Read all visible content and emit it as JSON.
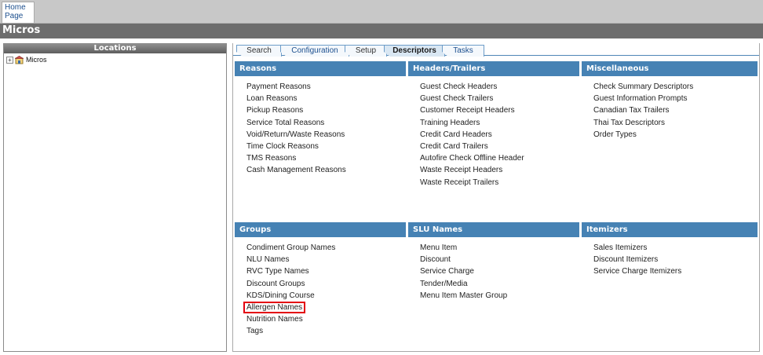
{
  "top_bar": {
    "home_tab": "Home\nPage"
  },
  "title_bar": {
    "title": "Micros"
  },
  "locations": {
    "header": "Locations",
    "tree": [
      {
        "expander": "+",
        "label": "Micros"
      }
    ]
  },
  "tabs": [
    {
      "label": "Search"
    },
    {
      "label": "Configuration"
    },
    {
      "label": "Setup"
    },
    {
      "label": "Descriptors",
      "active": true
    },
    {
      "label": "Tasks"
    }
  ],
  "sections": {
    "reasons": {
      "title": "Reasons",
      "items": [
        "Payment Reasons",
        "Loan Reasons",
        "Pickup Reasons",
        "Service Total Reasons",
        "Void/Return/Waste Reasons",
        "Time Clock Reasons",
        "TMS Reasons",
        "Cash Management Reasons"
      ]
    },
    "headers_trailers": {
      "title": "Headers/Trailers",
      "items": [
        "Guest Check Headers",
        "Guest Check Trailers",
        "Customer Receipt Headers",
        "Training Headers",
        "Credit Card Headers",
        "Credit Card Trailers",
        "Autofire Check Offline Header",
        "Waste Receipt Headers",
        "Waste Receipt Trailers"
      ]
    },
    "miscellaneous": {
      "title": "Miscellaneous",
      "items": [
        "Check Summary Descriptors",
        "Guest Information Prompts",
        "Canadian Tax Trailers",
        "Thai Tax Descriptors",
        "Order Types"
      ]
    },
    "groups": {
      "title": "Groups",
      "items": [
        "Condiment Group Names",
        "NLU Names",
        "RVC Type Names",
        "Discount Groups",
        "KDS/Dining Course",
        "Allergen Names",
        "Nutrition Names",
        "Tags"
      ],
      "highlighted": "Allergen Names"
    },
    "slu_names": {
      "title": "SLU Names",
      "items": [
        "Menu Item",
        "Discount",
        "Service Charge",
        "Tender/Media",
        "Menu Item Master Group"
      ]
    },
    "itemizers": {
      "title": "Itemizers",
      "items": [
        "Sales Itemizers",
        "Discount Itemizers",
        "Service Charge Itemizers"
      ]
    }
  },
  "colors": {
    "section_header": "#4682b4",
    "highlight": "#e3000f",
    "title_bar": "#6d6d6d"
  }
}
